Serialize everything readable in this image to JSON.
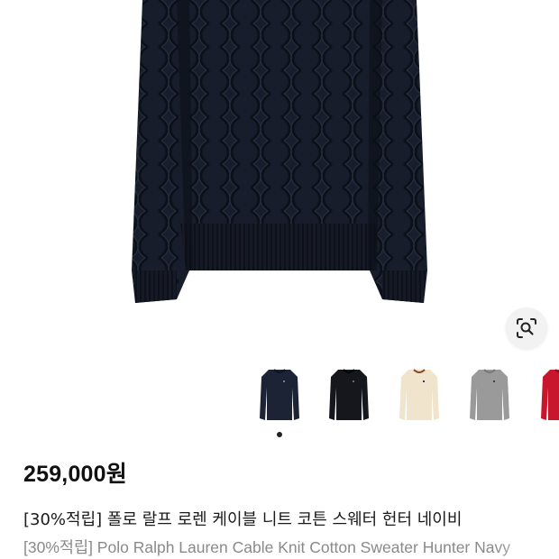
{
  "product": {
    "price": "259,000원",
    "title_ko": "[30%적립] 폴로 랄프 로렌 케이블 니트 코튼 스웨터 헌터 네이비",
    "title_en": "[30%적립] Polo Ralph Lauren Cable Knit Cotton Sweater Hunter Navy"
  },
  "gallery": {
    "lens_icon": "lens-search-icon",
    "active_index": 0,
    "thumbnails": [
      {
        "name": "navy",
        "color": "#1b2335",
        "selected": true
      },
      {
        "name": "black",
        "color": "#15171c",
        "selected": false
      },
      {
        "name": "cream",
        "color": "#f1e4cc",
        "selected": false
      },
      {
        "name": "grey",
        "color": "#9a9a9a",
        "selected": false
      },
      {
        "name": "red",
        "color": "#c8172c",
        "selected": false
      }
    ]
  },
  "colors": {
    "sweater": "#171c2a",
    "sweater_shadow": "#10141f",
    "text": "#111111",
    "subtext": "#8a8a8a"
  }
}
